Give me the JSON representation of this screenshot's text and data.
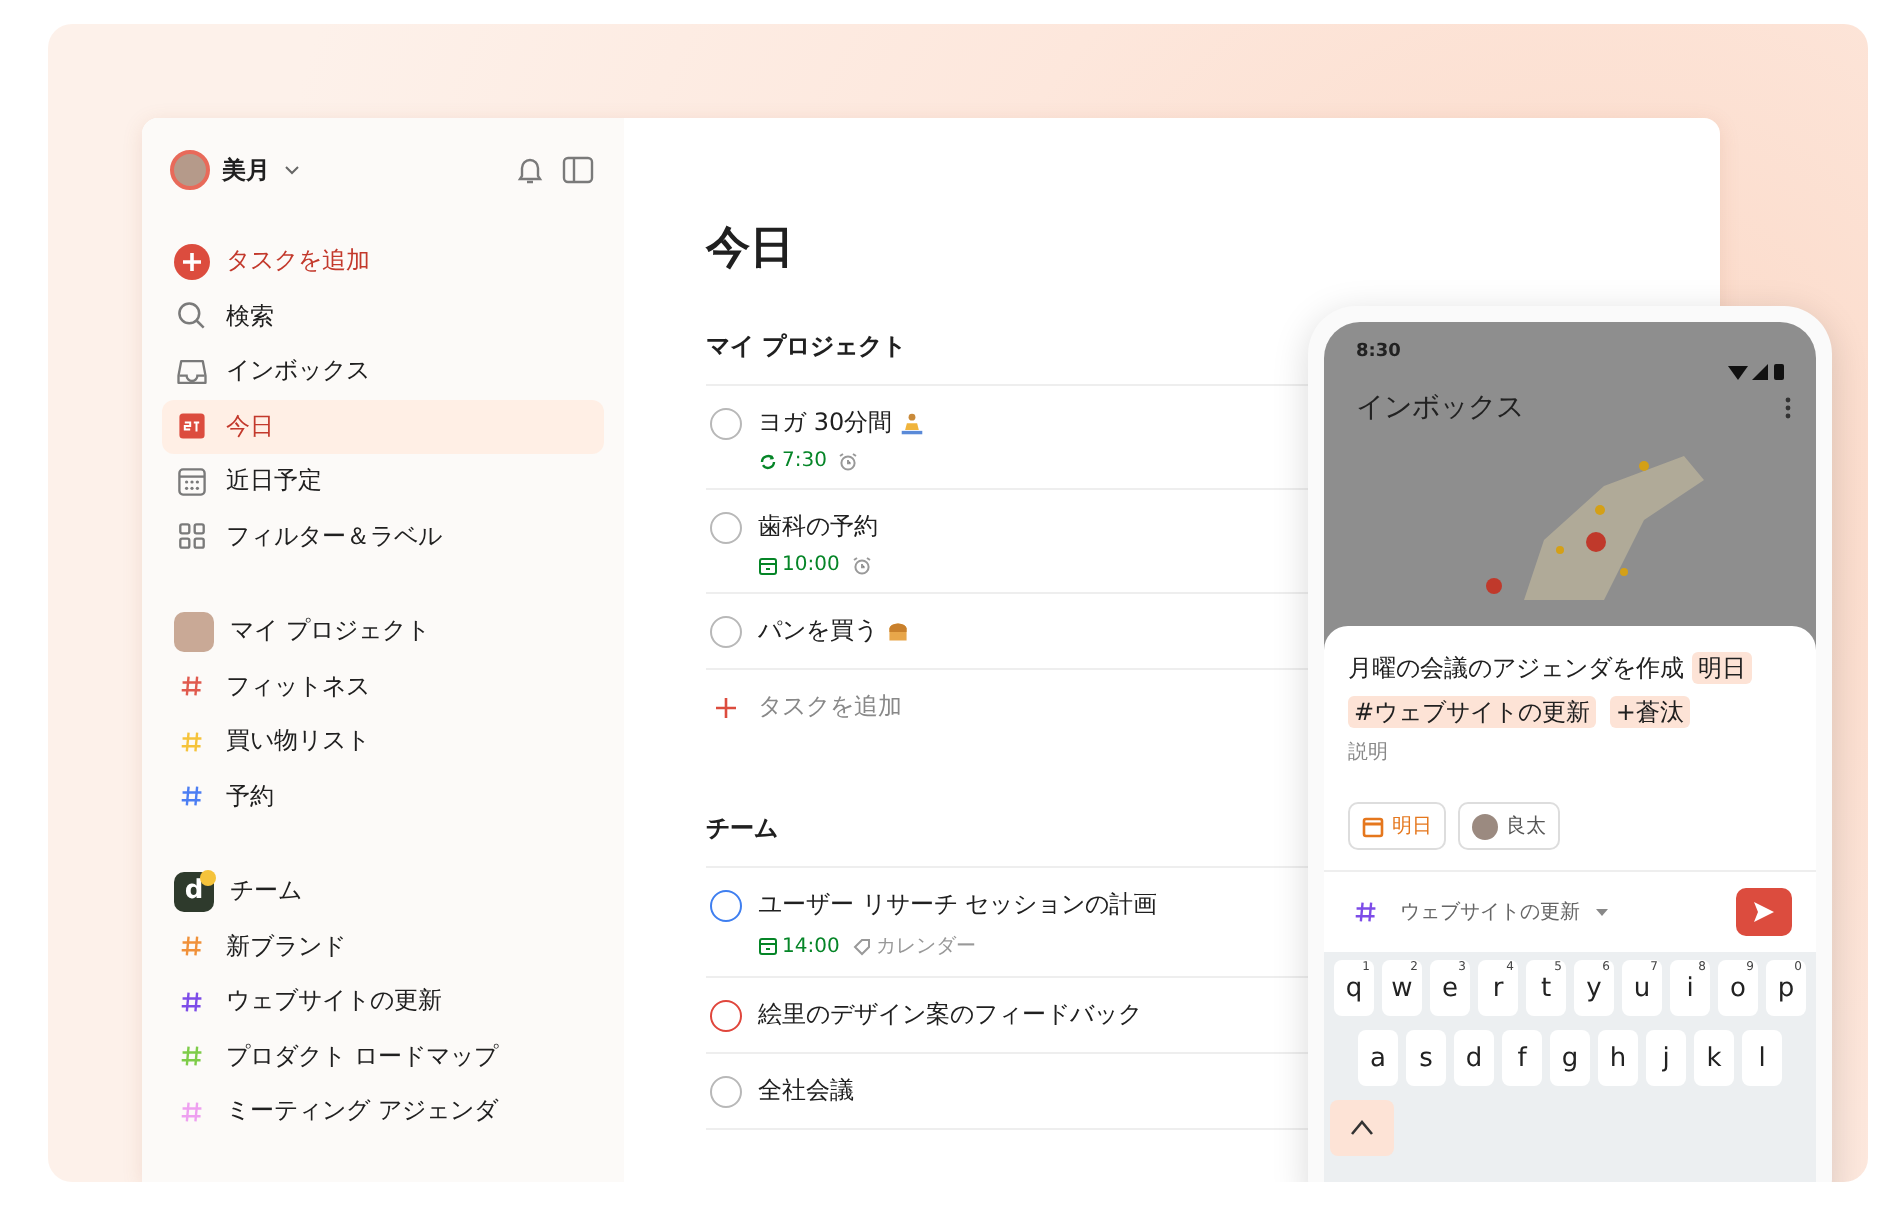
{
  "sidebar": {
    "user": {
      "name": "美月"
    },
    "nav": [
      {
        "kind": "add",
        "label": "タスクを追加",
        "selected": false
      },
      {
        "kind": "search",
        "label": "検索",
        "selected": false
      },
      {
        "kind": "inbox",
        "label": "インボックス",
        "selected": false
      },
      {
        "kind": "today",
        "label": "今日",
        "selected": true
      },
      {
        "kind": "upcoming",
        "label": "近日予定",
        "selected": false
      },
      {
        "kind": "filters",
        "label": "フィルター＆ラベル",
        "selected": false
      }
    ],
    "groups": [
      {
        "kind": "personal",
        "title": "マイ プロジェクト",
        "projects": [
          {
            "name": "フィットネス",
            "color": "#e05a4e"
          },
          {
            "name": "買い物リスト",
            "color": "#f5c33b"
          },
          {
            "name": "予約",
            "color": "#4c7ef3"
          }
        ]
      },
      {
        "kind": "team",
        "title": "チーム",
        "icon_letter": "d",
        "projects": [
          {
            "name": "新ブランド",
            "color": "#f0913a"
          },
          {
            "name": "ウェブサイトの更新",
            "color": "#7d4ce8"
          },
          {
            "name": "プロダクト ロードマップ",
            "color": "#7ecc49"
          },
          {
            "name": "ミーティング アジェンダ",
            "color": "#eea0f0"
          }
        ]
      }
    ]
  },
  "main": {
    "title": "今日",
    "sections": [
      {
        "title": "マイ プロジェクト",
        "add_label": "タスクを追加",
        "tasks": [
          {
            "title": "ヨガ 30分間",
            "kind": "meditation",
            "color": "#b8b8b8",
            "due": {
              "kind": "recurring",
              "time": "7:30"
            },
            "reminder": true
          },
          {
            "title": "歯科の予約",
            "color": "#b8b8b8",
            "due": {
              "kind": "date",
              "time": "10:00"
            },
            "reminder": true
          },
          {
            "title": "パンを買う",
            "kind": "bread",
            "color": "#b8b8b8"
          }
        ]
      },
      {
        "title": "チーム",
        "tasks": [
          {
            "title": "ユーザー リサーチ セッションの計画",
            "color": "#3f7ff0",
            "due": {
              "kind": "date",
              "time": "14:00"
            },
            "label": "カレンダー"
          },
          {
            "title": "絵里のデザイン案のフィードバック",
            "color": "#e0463c"
          },
          {
            "title": "全社会議",
            "color": "#b8b8b8"
          }
        ]
      }
    ]
  },
  "phone": {
    "time": "8:30",
    "title": "インボックス",
    "quick_add": {
      "text": "月曜の会議のアジェンダを作成",
      "tokens": [
        "明日",
        "#ウェブサイトの更新",
        "+蒼汰"
      ],
      "placeholder": "説明",
      "chips": [
        {
          "kind": "date",
          "label": "明日"
        },
        {
          "kind": "assignee",
          "label": "良太"
        }
      ],
      "project": "ウェブサイトの更新"
    },
    "keyboard": [
      [
        {
          "key": "q",
          "hint": "1"
        },
        {
          "key": "w",
          "hint": "2"
        },
        {
          "key": "e",
          "hint": "3"
        },
        {
          "key": "r",
          "hint": "4"
        },
        {
          "key": "t",
          "hint": "5"
        },
        {
          "key": "y",
          "hint": "6"
        },
        {
          "key": "u",
          "hint": "7"
        },
        {
          "key": "i",
          "hint": "8"
        },
        {
          "key": "o",
          "hint": "9"
        },
        {
          "key": "p",
          "hint": "0"
        }
      ],
      [
        {
          "key": "a"
        },
        {
          "key": "s"
        },
        {
          "key": "d"
        },
        {
          "key": "f"
        },
        {
          "key": "g"
        },
        {
          "key": "h"
        },
        {
          "key": "j"
        },
        {
          "key": "k"
        },
        {
          "key": "l"
        }
      ]
    ]
  }
}
